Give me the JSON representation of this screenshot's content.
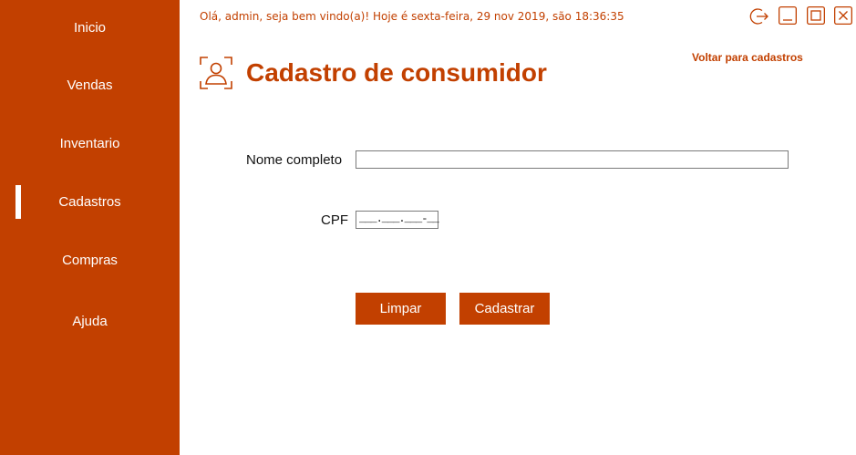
{
  "sidebar": {
    "items": [
      {
        "label": "Inicio"
      },
      {
        "label": "Vendas"
      },
      {
        "label": "Inventario"
      },
      {
        "label": "Cadastros",
        "active": true
      },
      {
        "label": "Compras"
      },
      {
        "label": "Ajuda"
      }
    ]
  },
  "header": {
    "greeting": "Olá, admin, seja bem vindo(a)! Hoje é sexta-feira, 29 nov 2019, são 18:36:35"
  },
  "window_controls": [
    "logout-icon",
    "minimize-icon",
    "maximize-icon",
    "close-icon"
  ],
  "page": {
    "title": "Cadastro de consumidor",
    "title_icon": "user-portrait-icon",
    "back_link": "Voltar para cadastros"
  },
  "form": {
    "name_label": "Nome completo",
    "name_value": "",
    "cpf_label": "CPF",
    "cpf_mask": "___.___.___-__"
  },
  "actions": {
    "clear_label": "Limpar",
    "submit_label": "Cadastrar"
  },
  "colors": {
    "accent": "#c24000",
    "background": "#ffffff",
    "sidebar_text": "#ffffff"
  }
}
